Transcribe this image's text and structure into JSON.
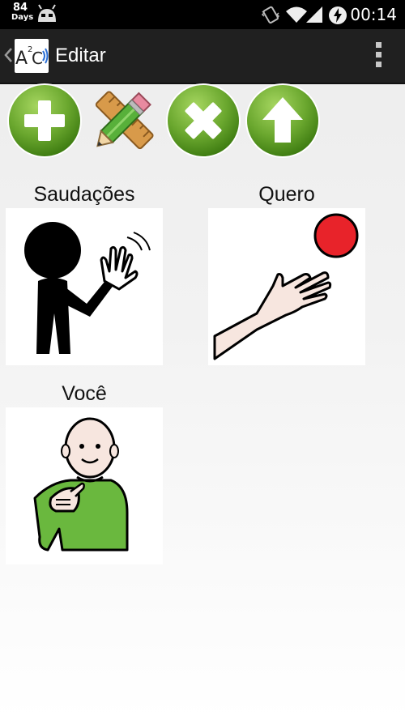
{
  "status_bar": {
    "days_number": "84",
    "days_label": "Days",
    "time": "00:14",
    "icons": [
      "android-icon",
      "vibrate-icon",
      "wifi-icon",
      "signal-icon",
      "battery-charging-icon"
    ]
  },
  "action_bar": {
    "title": "Editar",
    "logo_text": "A²C",
    "icons": [
      "up-chevron-icon",
      "app-logo-icon",
      "overflow-menu-icon"
    ]
  },
  "toolbar": {
    "buttons": [
      "add-icon",
      "edit-icon",
      "delete-icon",
      "move-up-icon"
    ]
  },
  "cards": [
    {
      "label": "Saudações",
      "icon": "waving-person-pictogram"
    },
    {
      "label": "Quero",
      "icon": "hand-reaching-ball-pictogram"
    },
    {
      "label": "Você",
      "icon": "person-pointing-pictogram"
    }
  ],
  "colors": {
    "green_button": "#6aa72e",
    "green_button_dark": "#3f7d12",
    "action_bar": "#202020",
    "ball_red": "#e8232a",
    "shirt_green": "#6ab83e"
  }
}
